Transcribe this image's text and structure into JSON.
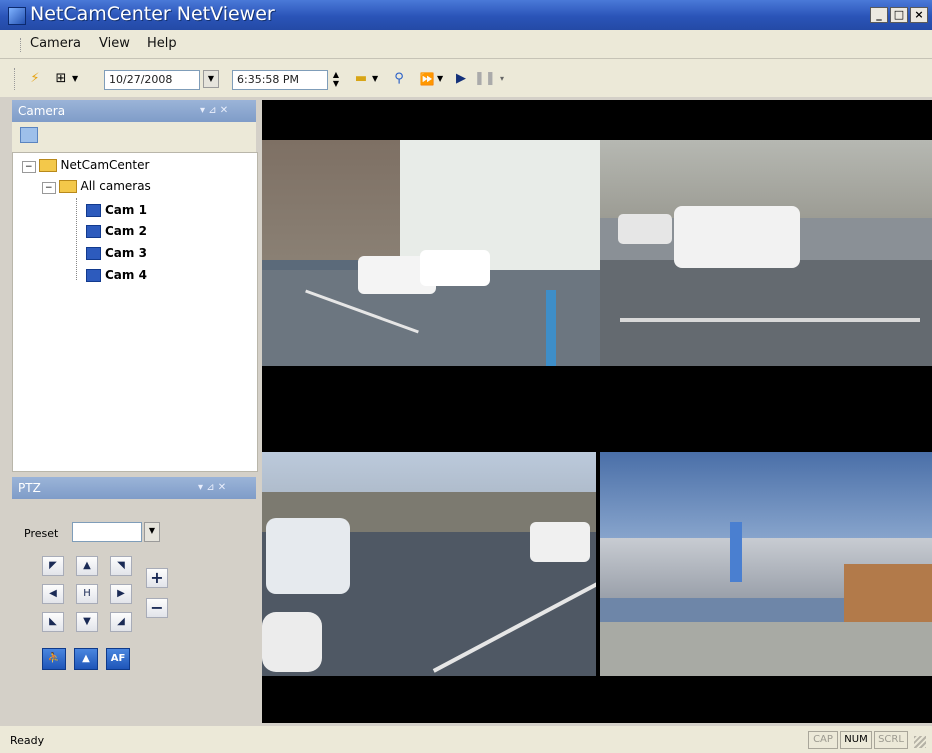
{
  "window": {
    "title": "NetCamCenter NetViewer",
    "minimize": "_",
    "maximize": "□",
    "close": "×"
  },
  "menu": {
    "items": [
      "Camera",
      "View",
      "Help"
    ]
  },
  "toolbar": {
    "date": "10/27/2008",
    "time": "6:35:58 PM",
    "icons": [
      "lightning-icon",
      "layout-grid-icon",
      "calendar-icon",
      "zoom-icon",
      "fast-forward-icon",
      "play-icon",
      "pause-icon"
    ]
  },
  "camera_panel": {
    "title": "Camera",
    "tree": {
      "root": "NetCamCenter",
      "group": "All cameras",
      "cameras": [
        "Cam 1",
        "Cam 2",
        "Cam 3",
        "Cam 4"
      ]
    }
  },
  "ptz_panel": {
    "title": "PTZ",
    "preset_label": "Preset",
    "preset_value": "",
    "zoom_in": "+",
    "zoom_out": "−",
    "af_label": "AF",
    "home_label": "H"
  },
  "status": {
    "text": "Ready",
    "caps": "CAP",
    "num": "NUM",
    "scrl": "SCRL"
  },
  "colors": {
    "title_bar": "#2a54b8",
    "panel_header": "#8aa6d2",
    "video_bg": "#000000"
  }
}
